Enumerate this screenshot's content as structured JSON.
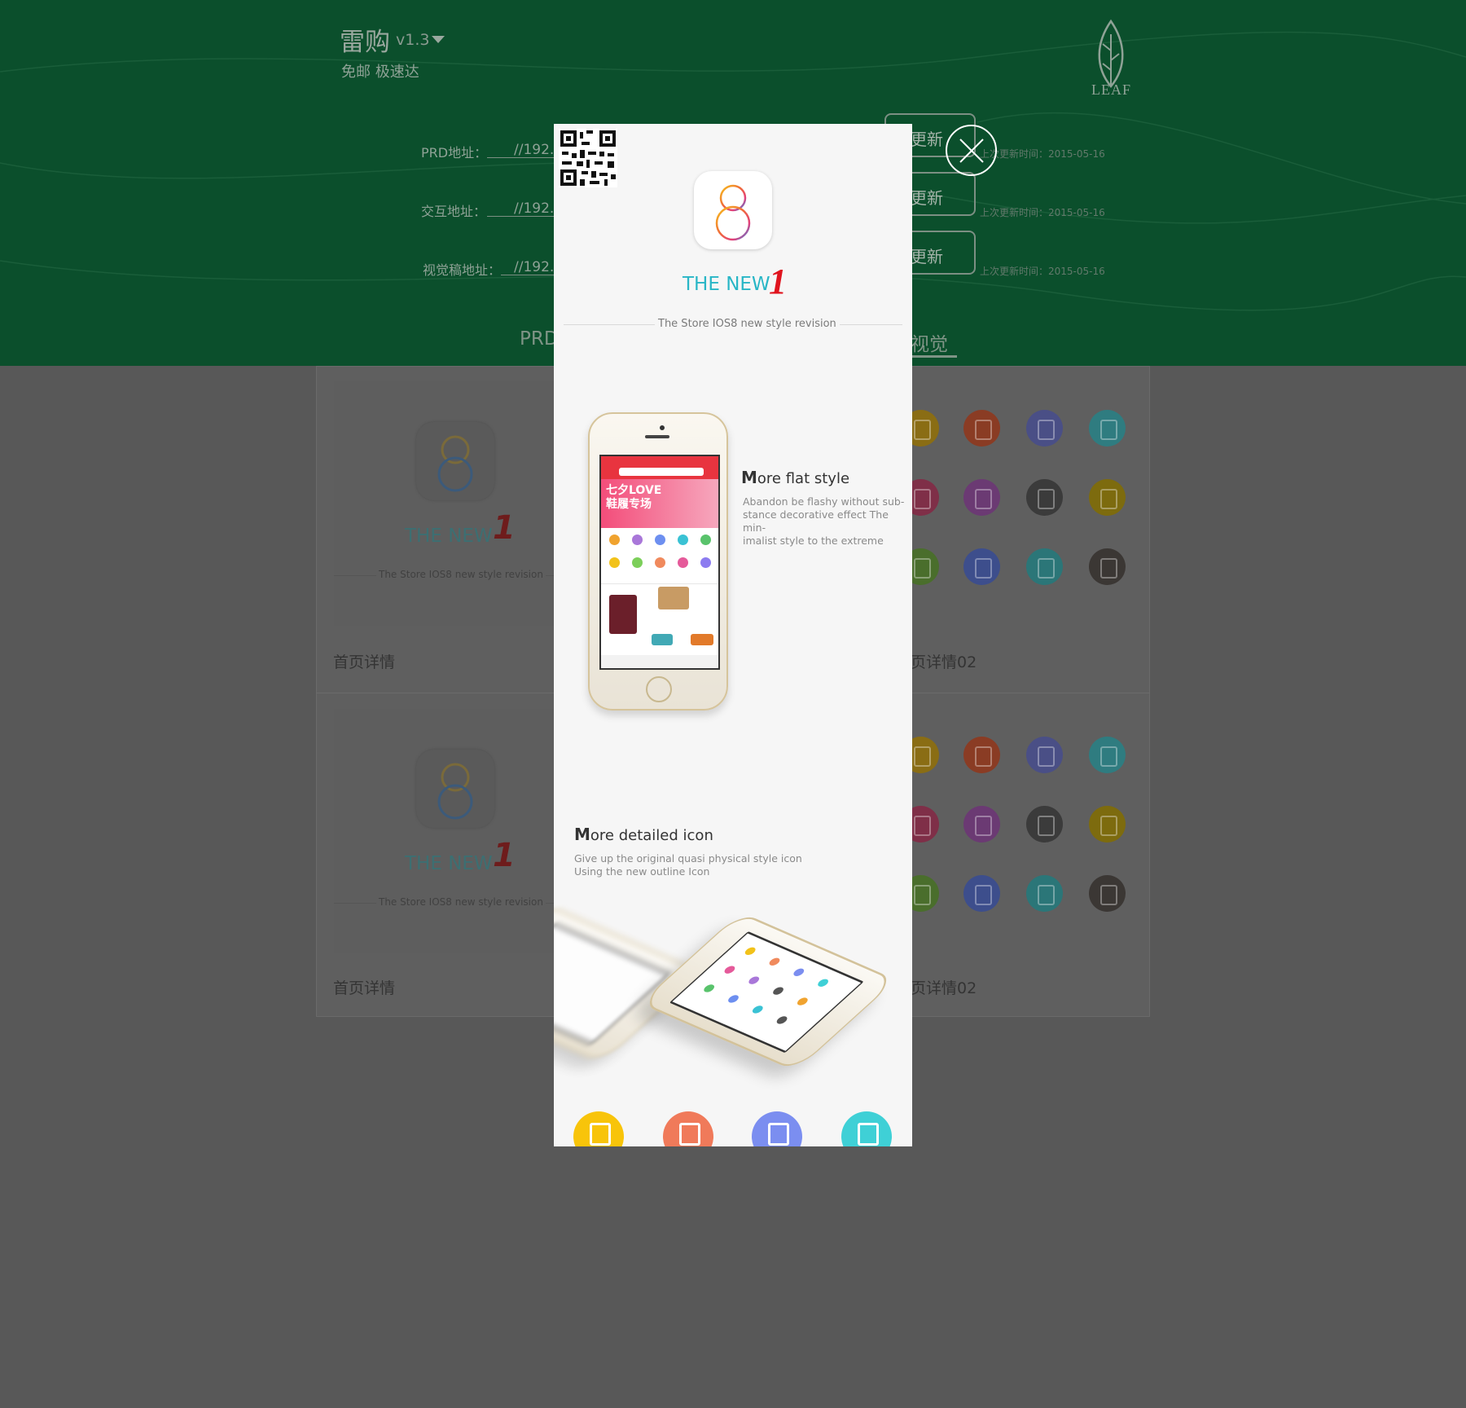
{
  "header": {
    "app_title": "雷购",
    "version": "v1.3",
    "subtitle": "免邮 极速达",
    "brand": "LEAF",
    "brand_icon": "leaf-icon",
    "addresses": [
      {
        "label": "PRD地址：",
        "value": "//192.",
        "button": "更新",
        "updated": "上次更新时间：2015-05-16"
      },
      {
        "label": "交互地址：",
        "value": "//192.",
        "button": "更新",
        "updated": "上次更新时间：2015-05-16"
      },
      {
        "label": "视觉稿地址：",
        "value": "//192.",
        "button": "更新",
        "updated": "上次更新时间：2015-05-16"
      }
    ],
    "tabs": [
      {
        "label": "PRD"
      },
      {
        "label": "视觉",
        "active": true
      }
    ]
  },
  "cards": [
    {
      "caption": "首页详情",
      "thumb_title": "THE NEW",
      "thumb_tag": "The Store IOS8 new style revision"
    },
    {
      "caption": "页详情02"
    },
    {
      "caption": "首页详情",
      "thumb_title": "THE NEW",
      "thumb_tag": "The Store IOS8 new style revision"
    },
    {
      "caption": "页详情02"
    }
  ],
  "card_icon_colors": [
    "#8a6d14",
    "#8a3c24",
    "#4a4f86",
    "#2f7c80",
    "#7f2f48",
    "#6b3a73",
    "#3b3b3b",
    "#7d6b0e",
    "#4a6e2c",
    "#3d4e8c",
    "#2b7678",
    "#3b3734"
  ],
  "modal": {
    "hero_title": "THE NEW",
    "hero_number": "1",
    "hero_tag": "The Store IOS8 new style revision",
    "feature1": {
      "title_first": "M",
      "title_rest": "ore flat style",
      "desc_lines": [
        "Abandon be flashy without sub-",
        "stance decorative effect The min-",
        "imalist style to the extreme"
      ]
    },
    "phone_banner_text": "七夕LOVE\n鞋履专场",
    "feature2": {
      "title_first": "M",
      "title_rest": "ore detailed icon",
      "desc_lines": [
        "Give up the original quasi physical style icon",
        "Using the new outline Icon"
      ]
    },
    "bottom_icon_colors": [
      "#f8c40a",
      "#f07a5a",
      "#7b8ef0",
      "#3fd0d6"
    ]
  },
  "close_icon": "close-icon"
}
